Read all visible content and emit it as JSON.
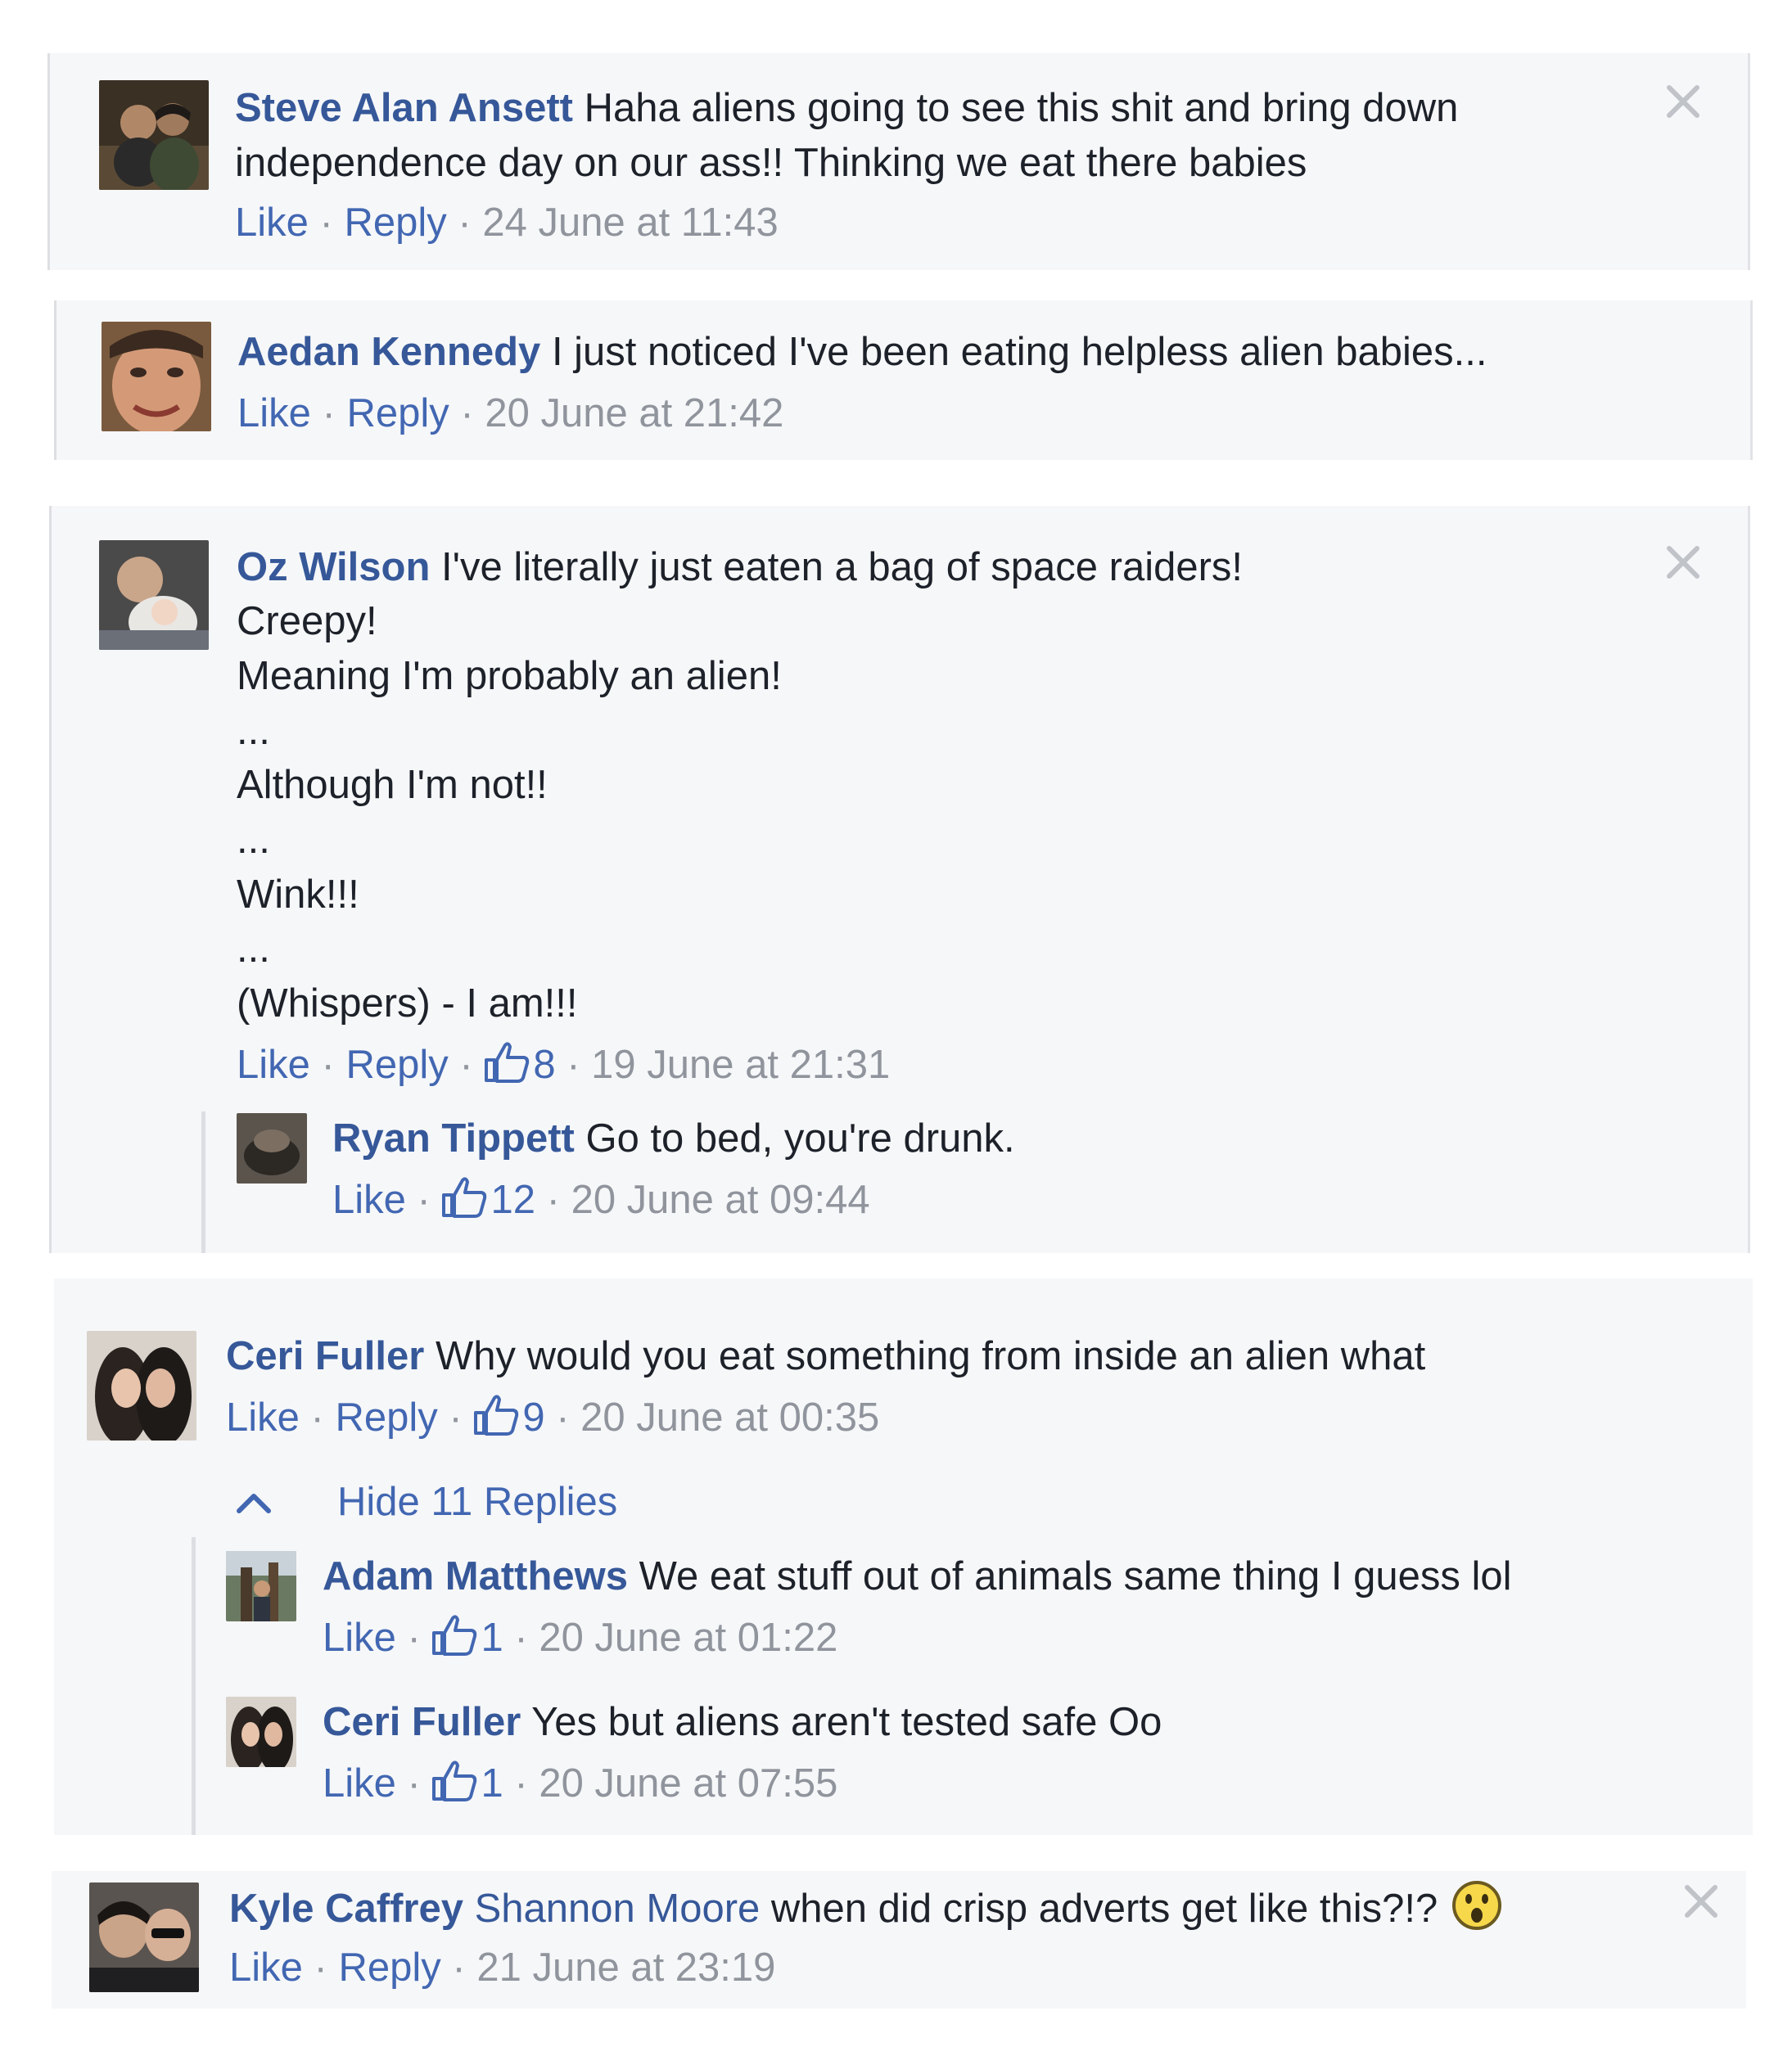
{
  "ui": {
    "like": "Like",
    "reply": "Reply",
    "sep": "·"
  },
  "comments": [
    {
      "author": "Steve Alan Ansett",
      "lines": [
        "Haha aliens going to see this shit and bring down",
        "independence day on our ass!! Thinking we eat there babies"
      ],
      "timestamp": "24 June at 11:43"
    },
    {
      "author": "Aedan Kennedy",
      "lines": [
        "I just noticed I've been eating helpless alien babies..."
      ],
      "timestamp": "20 June at 21:42"
    },
    {
      "author": "Oz Wilson",
      "lines": [
        "I've literally just eaten a bag of space raiders!",
        "Creepy!",
        "Meaning I'm probably an alien!",
        "...",
        "Although I'm not!!",
        "...",
        "Wink!!!",
        "...",
        "(Whispers) - I am!!!"
      ],
      "likes": "8",
      "timestamp": "19 June at 21:31",
      "replies": [
        {
          "author": "Ryan Tippett",
          "text": "Go to bed, you're drunk.",
          "likes": "12",
          "timestamp": "20 June at 09:44"
        }
      ]
    },
    {
      "author": "Ceri Fuller",
      "lines": [
        "Why would you eat something from inside an alien what"
      ],
      "likes": "9",
      "timestamp": "20 June at 00:35",
      "hide_replies": "Hide 11 Replies",
      "replies": [
        {
          "author": "Adam Matthews",
          "text": "We eat stuff out of animals same thing I guess lol",
          "likes": "1",
          "timestamp": "20 June at 01:22"
        },
        {
          "author": "Ceri Fuller",
          "text": "Yes but aliens aren't tested safe Oo",
          "likes": "1",
          "timestamp": "20 June at 07:55"
        }
      ]
    },
    {
      "author": "Kyle Caffrey",
      "tagged": "Shannon Moore",
      "lines": [
        "when did crisp adverts get like this?!?"
      ],
      "emoji": "surprised-face-emoji",
      "timestamp": "21 June at 23:19"
    }
  ],
  "colors": {
    "name": "#365899",
    "action": "#4267b2",
    "meta": "#90949c",
    "background": "#f6f7f9",
    "text": "#1d2129"
  },
  "icons": {
    "like": "thumbs-up-icon",
    "close": "close-icon",
    "collapse": "chevron-up-icon"
  }
}
